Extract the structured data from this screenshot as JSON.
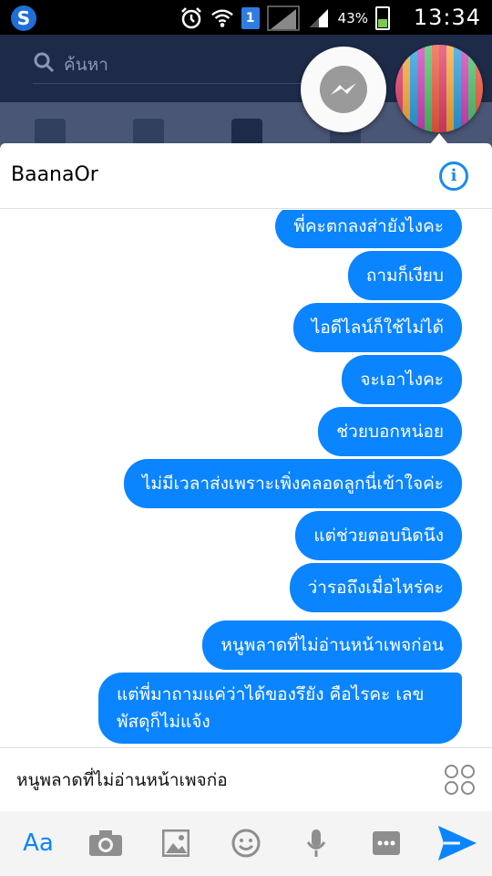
{
  "status_bar": {
    "battery_percent": "43%",
    "time": "13:34",
    "sim_label": "1"
  },
  "background_app": {
    "search_placeholder": "ค้นหา"
  },
  "chat": {
    "title": "BaanaOr",
    "messages": [
      "พี่คะตกลงส่ายังไงคะ",
      "ถามก็เงียบ",
      "ไอดีไลน์ก็ใช้ไม่ได้",
      "จะเอาไงคะ",
      "ช่วยบอกหน่อย",
      "ไม่มีเวลาส่งเพราะเพิ่งคลอดลูกนี่เข้าใจค่ะ",
      "แต่ช่วยตอบนิดนึง",
      "ว่ารอถึงเมื่อไหร่คะ",
      "หนูพลาดที่ไม่อ่านหน้าเพจก่อน",
      "แต่พี่มาถามแค่ว่าได้ของรึยัง คือไรคะ เลขพัสดุก็ไม่แจ้ง"
    ],
    "composer_text": "หนูพลาดที่ไม่อ่านหน้าเพจก่อ",
    "toolbar": {
      "aa_label": "Aa"
    }
  },
  "colors": {
    "accent": "#0a84ff",
    "fb_dark": "#1d2a48"
  },
  "icons": [
    "messenger-icon",
    "camera-icon",
    "gallery-icon",
    "emoji-icon",
    "microphone-icon",
    "more-icon",
    "send-icon",
    "info-icon",
    "sticker-icon",
    "search-icon",
    "alarm-icon",
    "wifi-icon",
    "signal-icon",
    "battery-icon"
  ]
}
